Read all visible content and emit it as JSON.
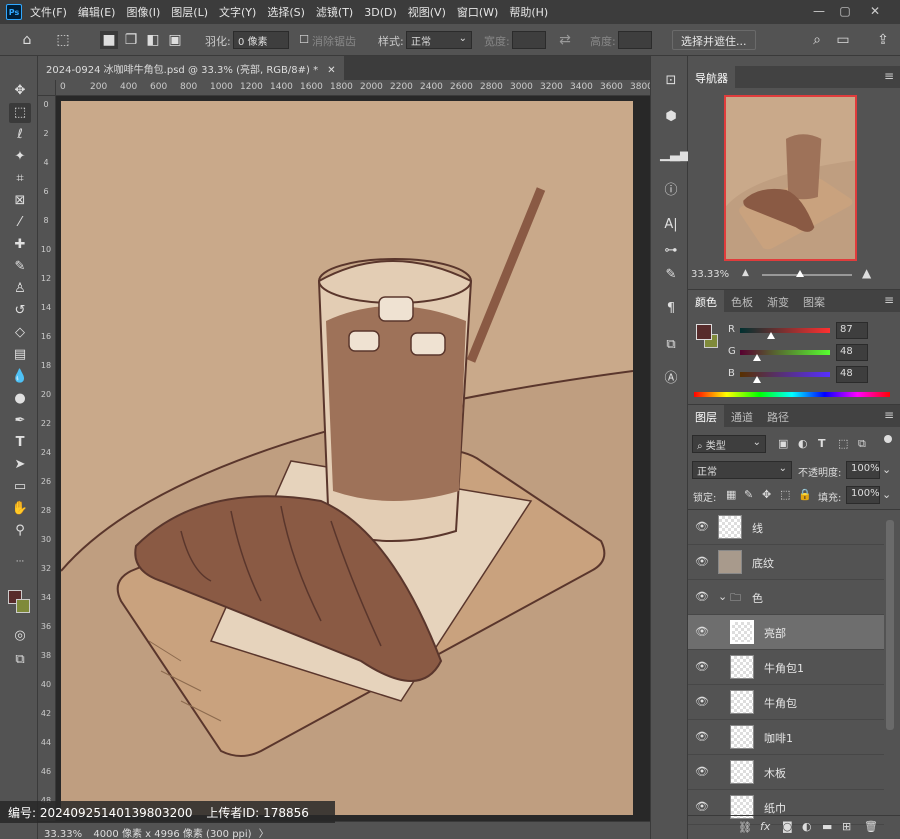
{
  "app": {
    "logo": "Ps"
  },
  "menu": [
    "文件(F)",
    "编辑(E)",
    "图像(I)",
    "图层(L)",
    "文字(Y)",
    "选择(S)",
    "滤镜(T)",
    "3D(D)",
    "视图(V)",
    "窗口(W)",
    "帮助(H)"
  ],
  "window_controls": {
    "minimize": "—",
    "restore": "▢",
    "close": "✕"
  },
  "options": {
    "feather_label": "羽化:",
    "feather_value": "0 像素",
    "antialias_label": "消除锯齿",
    "style_label": "样式:",
    "style_value": "正常",
    "width_label": "宽度:",
    "height_label": "高度:",
    "select_mask_button": "选择并遮住..."
  },
  "document": {
    "tab_title": "2024-0924 冰咖啡牛角包.psd @ 33.3% (亮部, RGB/8#) *",
    "close": "✕"
  },
  "ruler": {
    "h_ticks": [
      "0",
      "200",
      "400",
      "600",
      "800",
      "1000",
      "1200",
      "1400",
      "1600",
      "1800",
      "2000",
      "2200",
      "2400",
      "2600",
      "2800",
      "3000",
      "3200",
      "3400",
      "3600",
      "3800"
    ],
    "v_ticks": [
      "0",
      "2",
      "4",
      "6",
      "8",
      "10",
      "12",
      "14",
      "16",
      "18",
      "20",
      "22",
      "24",
      "26",
      "28",
      "30",
      "32",
      "34",
      "36",
      "38",
      "40",
      "42",
      "44",
      "46",
      "48"
    ]
  },
  "status": {
    "zoom": "33.33%",
    "doc_size": "4000 像素 x 4996 像素 (300 ppi)",
    "arrow": "〉"
  },
  "watermark_bar": {
    "id_label": "编号:",
    "id_value": "20240925140139803200",
    "uploader_label": "上传者ID:",
    "uploader_value": "178856"
  },
  "navigator": {
    "tab": "导航器",
    "zoom": "33.33%"
  },
  "color_panel": {
    "tabs": [
      "颜色",
      "色板",
      "渐变",
      "图案"
    ],
    "fg_color": "#572B2B",
    "bg_color": "#7F8A3A",
    "r_label": "R",
    "r_value": "87",
    "g_label": "G",
    "g_value": "48",
    "b_label": "B",
    "b_value": "48"
  },
  "layers_panel": {
    "tabs": [
      "图层",
      "通道",
      "路径"
    ],
    "filter_value": "类型",
    "blend_mode": "正常",
    "opacity_label": "不透明度:",
    "opacity_value": "100%",
    "lock_label": "锁定:",
    "fill_label": "填充:",
    "fill_value": "100%",
    "layers": [
      {
        "name": "线",
        "indent": 0,
        "group": false,
        "selected": false
      },
      {
        "name": "底纹",
        "indent": 0,
        "group": false,
        "selected": false
      },
      {
        "name": "色",
        "indent": 0,
        "group": true,
        "selected": false
      },
      {
        "name": "亮部",
        "indent": 1,
        "group": false,
        "selected": true
      },
      {
        "name": "牛角包1",
        "indent": 1,
        "group": false,
        "selected": false
      },
      {
        "name": "牛角包",
        "indent": 1,
        "group": false,
        "selected": false
      },
      {
        "name": "咖啡1",
        "indent": 1,
        "group": false,
        "selected": false
      },
      {
        "name": "木板",
        "indent": 1,
        "group": false,
        "selected": false
      },
      {
        "name": "纸巾",
        "indent": 1,
        "group": false,
        "selected": false
      }
    ]
  },
  "colors": {
    "paper": "#C9A98A",
    "table": "#BF9E80",
    "coffee": "#9E7259",
    "croissant": "#8A5A44",
    "board": "#C9A27E",
    "napkin": "#E6D3BC",
    "line": "#5A362C"
  }
}
